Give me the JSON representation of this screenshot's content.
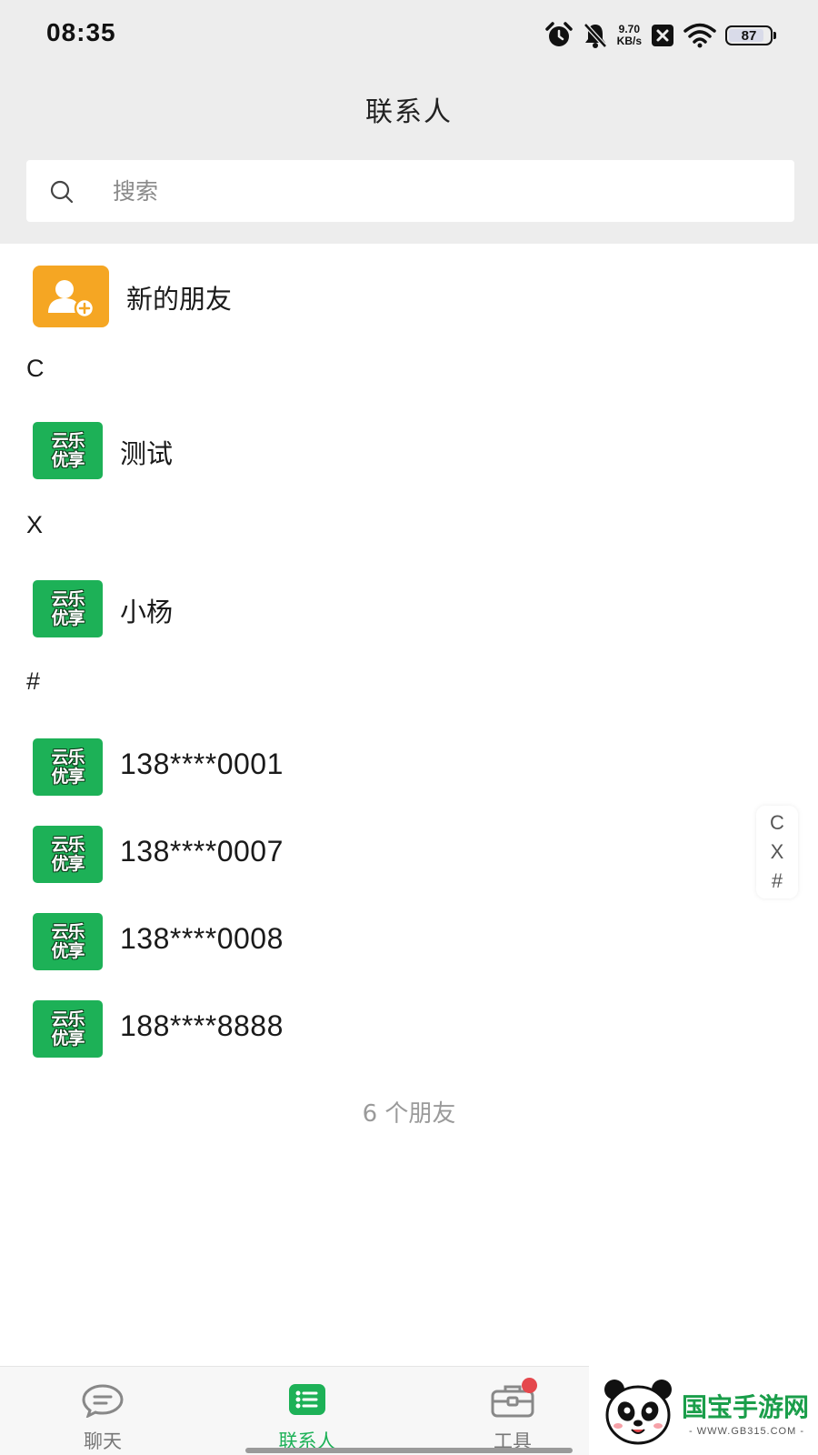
{
  "status_bar": {
    "time": "08:35",
    "net_speed_value": "9.70",
    "net_speed_unit": "KB/s",
    "battery_level": "87"
  },
  "header": {
    "title": "联系人"
  },
  "search": {
    "placeholder": "搜索"
  },
  "new_friends": {
    "label": "新的朋友"
  },
  "sections": [
    {
      "letter": "C",
      "contacts": [
        {
          "name": "测试"
        }
      ]
    },
    {
      "letter": "X",
      "contacts": [
        {
          "name": "小杨"
        }
      ]
    },
    {
      "letter": "#",
      "contacts": [
        {
          "name": "138****0001"
        },
        {
          "name": "138****0007"
        },
        {
          "name": "138****0008"
        },
        {
          "name": "188****8888"
        }
      ]
    }
  ],
  "avatar_logo": {
    "line1": "云乐",
    "line2": "优享"
  },
  "friend_count": "6 个朋友",
  "side_index": [
    "C",
    "X",
    "#"
  ],
  "tabs": [
    {
      "label": "聊天",
      "icon": "chat-bubble-icon",
      "active": false
    },
    {
      "label": "联系人",
      "icon": "contact-list-icon",
      "active": true
    },
    {
      "label": "工具",
      "icon": "toolbox-icon",
      "active": false,
      "badge": true
    }
  ],
  "watermark": {
    "text": "国宝手游网",
    "url": "- WWW.GB315.COM -"
  },
  "colors": {
    "accent_green": "#1db157",
    "new_friend_orange": "#f5a623",
    "badge_red": "#e5484d",
    "header_bg": "#ededed"
  }
}
